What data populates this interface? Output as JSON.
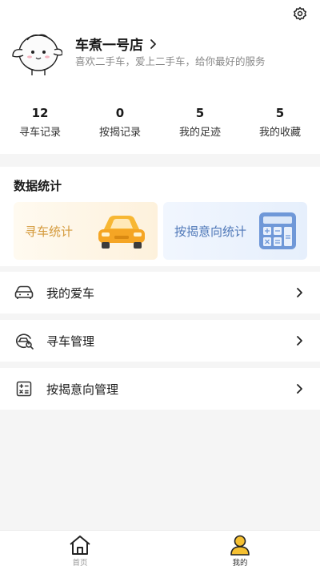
{
  "profile": {
    "name": "车煮一号店",
    "bio": "喜欢二手车，爱上二手车，给你最好的服务"
  },
  "stats": [
    {
      "value": "12",
      "label": "寻车记录"
    },
    {
      "value": "0",
      "label": "按揭记录"
    },
    {
      "value": "5",
      "label": "我的足迹"
    },
    {
      "value": "5",
      "label": "我的收藏"
    }
  ],
  "data_section": {
    "title": "数据统计",
    "car_tile_label": "寻车统计",
    "calc_tile_label": "按揭意向统计"
  },
  "menu": [
    {
      "label": "我的爱车",
      "icon": "car-icon"
    },
    {
      "label": "寻车管理",
      "icon": "car-search-icon"
    },
    {
      "label": "按揭意向管理",
      "icon": "calculator-icon"
    }
  ],
  "tabbar": [
    {
      "label": "首页",
      "icon": "home-icon",
      "active": false
    },
    {
      "label": "我的",
      "icon": "user-icon",
      "active": true
    }
  ],
  "colors": {
    "accent_yellow": "#f5c032",
    "car_tile_text": "#d49a3c",
    "calc_tile_text": "#4f78b8"
  }
}
